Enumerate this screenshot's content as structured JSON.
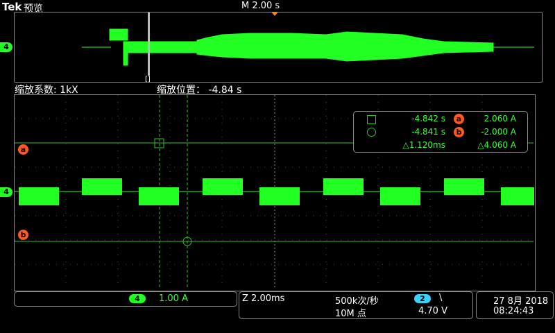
{
  "header": {
    "brand": "Tek",
    "mode": "预览",
    "timebase": "M 2.00 s"
  },
  "overview": {
    "channel_marker": "4",
    "zoom_bracket": "[]"
  },
  "zoom_info": {
    "factor": "缩放系数: 1kX",
    "position": "缩放位置： -4.84 s"
  },
  "cursor_readout": {
    "row1": {
      "time": "-4.842 s",
      "tag": "a",
      "value": "2.060 A"
    },
    "row2": {
      "time": "-4.841 s",
      "tag": "b",
      "value": "-2.000 A"
    },
    "row3": {
      "dt": "△1.120ms",
      "dv": "△4.060 A"
    }
  },
  "markers": {
    "cursor_a": "a",
    "cursor_b": "b",
    "channel_marker": "4"
  },
  "status_bar": {
    "channel_badge": "4",
    "channel_scale": "1.00 A",
    "zoom_scale": "Z 2.00ms",
    "sample_rate": "500k次/秒",
    "record_length": "10M 点",
    "trigger_source": "2",
    "trigger_slope": "\\",
    "trigger_level": "4.70 V",
    "date": "27 8月 2018",
    "time": "08:24:43"
  },
  "colors": {
    "trace": "#22ff22",
    "cursor": "#33cc33",
    "marker_orange": "#ff5a1e",
    "trigger_cyan": "#39d3ff"
  }
}
